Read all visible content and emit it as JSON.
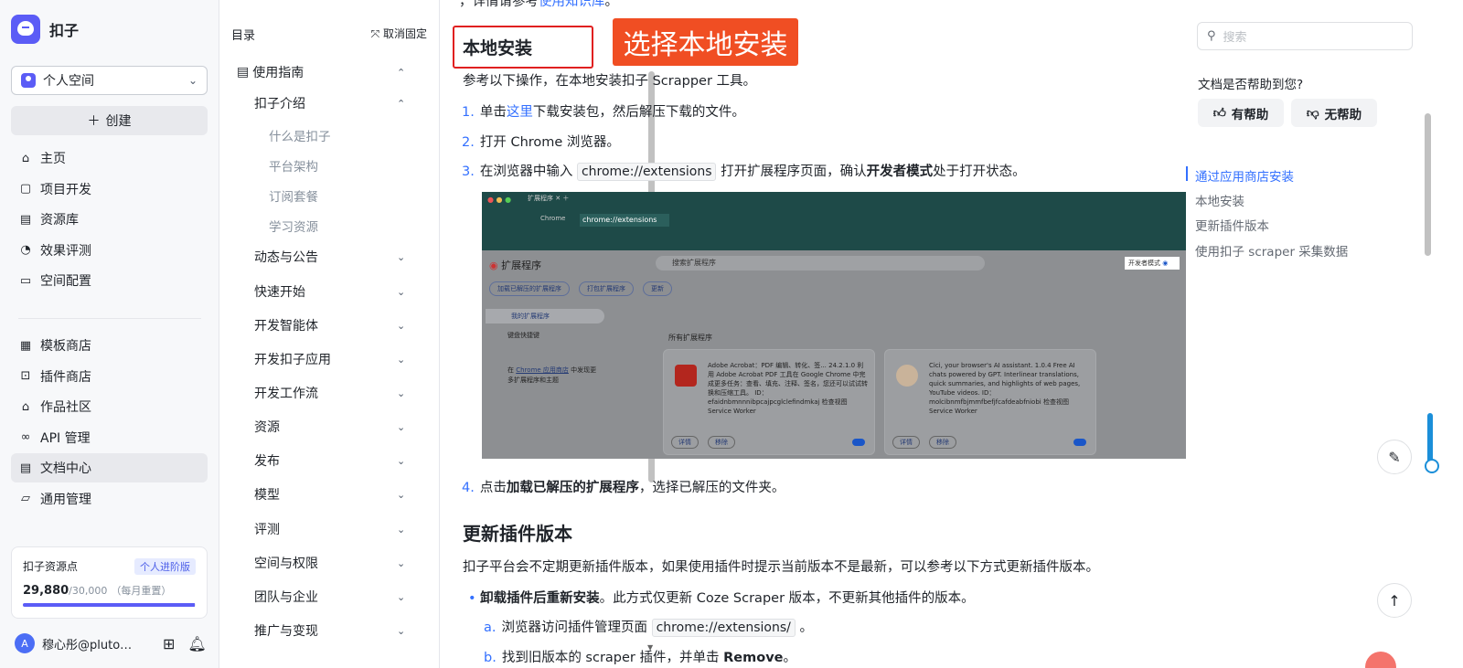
{
  "brand": {
    "name": "扣子"
  },
  "space": {
    "label": "个人空间"
  },
  "create_label": "创建",
  "nav_primary": [
    {
      "label": "主页",
      "icon": "home-icon"
    },
    {
      "label": "项目开发",
      "icon": "project-icon"
    },
    {
      "label": "资源库",
      "icon": "library-icon"
    },
    {
      "label": "效果评测",
      "icon": "evaluate-icon"
    },
    {
      "label": "空间配置",
      "icon": "space-config-icon"
    }
  ],
  "nav_secondary": [
    {
      "label": "模板商店",
      "icon": "template-icon"
    },
    {
      "label": "插件商店",
      "icon": "plugin-icon"
    },
    {
      "label": "作品社区",
      "icon": "community-icon"
    },
    {
      "label": "API 管理",
      "icon": "api-icon"
    },
    {
      "label": "文档中心",
      "icon": "doc-icon",
      "active": true
    },
    {
      "label": "通用管理",
      "icon": "manage-icon"
    }
  ],
  "points": {
    "title": "扣子资源点",
    "badge": "个人进阶版",
    "value": "29,880",
    "max": "/30,000",
    "reset": "（每月重置）",
    "fraction": 0.996
  },
  "user": {
    "name": "穆心彤@pluto…",
    "avatar_letter": "A"
  },
  "doctree": {
    "title": "目录",
    "unpin": "取消固定",
    "items": [
      {
        "label": "使用指南",
        "level": 0,
        "expanded": true
      },
      {
        "label": "扣子介绍",
        "level": 1,
        "expanded": true
      },
      {
        "label": "什么是扣子",
        "level": 2
      },
      {
        "label": "平台架构",
        "level": 2
      },
      {
        "label": "订阅套餐",
        "level": 2
      },
      {
        "label": "学习资源",
        "level": 2
      },
      {
        "label": "动态与公告",
        "level": 1
      },
      {
        "label": "快速开始",
        "level": 1
      },
      {
        "label": "开发智能体",
        "level": 1
      },
      {
        "label": "开发扣子应用",
        "level": 1
      },
      {
        "label": "开发工作流",
        "level": 1
      },
      {
        "label": "资源",
        "level": 1
      },
      {
        "label": "发布",
        "level": 1
      },
      {
        "label": "模型",
        "level": 1
      },
      {
        "label": "评测",
        "level": 1
      },
      {
        "label": "空间与权限",
        "level": 1
      },
      {
        "label": "团队与企业",
        "level": 1
      },
      {
        "label": "推广与变现",
        "level": 1
      }
    ]
  },
  "content": {
    "top_text_pre": "，详情请参考",
    "top_link": "使用知识库",
    "top_text_post": "。",
    "h_local": "本地安装",
    "annotation": "选择本地安装",
    "intro": "参考以下操作，在本地安装扣子 Scrapper 工具。",
    "step1_pre": "单击",
    "step1_link": "这里",
    "step1_post": "下载安装包，然后解压下载的文件。",
    "step2": "打开 Chrome 浏览器。",
    "step3_pre": "在浏览器中输入",
    "step3_code": "chrome://extensions",
    "step3_mid": "打开扩展程序页面，确认",
    "step3_bold": "开发者模式",
    "step3_post": "处于打开状态。",
    "step4_pre": "点击",
    "step4_bold": "加载已解压的扩展程序",
    "step4_post": "，选择已解压的文件夹。",
    "h_update": "更新插件版本",
    "update_intro": "扣子平台会不定期更新插件版本，如果使用插件时提示当前版本不是最新，可以参考以下方式更新插件版本。",
    "bullet_bold": "卸载插件后重新安装",
    "bullet_post": "。此方式仅更新 Coze Scraper 版本，不更新其他插件的版本。",
    "sub_a_pre": "浏览器访问插件管理页面",
    "sub_a_code": "chrome://extensions/",
    "sub_a_post": "。",
    "sub_b_pre": "找到旧版本的 scraper 插件，并单击",
    "sub_b_bold": "Remove",
    "sub_b_post": "。",
    "num1": "1.",
    "num2": "2.",
    "num3": "3.",
    "num4": "4.",
    "sub_a": "a.",
    "sub_b": "b."
  },
  "screenshot": {
    "url": "chrome://extensions",
    "url_host": "Chrome",
    "tab": "扩展程序",
    "title": "扩展程序",
    "search": "搜索扩展程序",
    "dev_mode": "开发者模式",
    "btn_load": "加载已解压的扩展程序",
    "btn_pack": "打包扩展程序",
    "btn_update": "更新",
    "side_mine": "我的扩展程序",
    "side_keys": "键盘快捷键",
    "side_store_pre": "在 ",
    "side_store_link": "Chrome 应用商店",
    "side_store_post": " 中发现更多扩展程序和主题",
    "all_ext": "所有扩展程序",
    "card1": "Adobe Acrobat：PDF 编辑、转化、签... 24.2.1.0 利用 Adobe Acrobat PDF 工具在 Google Chrome 中完成更多任务：查看、填充、注释、签名，您还可以试试转换和压缩工具。 ID：efaidnbmnnnibpcajpcglclefindmkaj 检查视图 Service Worker",
    "card2": "Cici, your browser's AI assistant. 1.0.4 Free AI chats powered by GPT. Interlinear translations, quick summaries, and highlights of web pages, YouTube videos. ID：molcibnmfbjmmfbefjfcafdeabfniobi 检查视图 Service Worker",
    "details": "详情",
    "remove": "移除"
  },
  "right": {
    "search_placeholder": "搜索",
    "help_question": "文档是否帮助到您?",
    "helpful": "有帮助",
    "not_helpful": "无帮助",
    "outline": [
      {
        "label": "通过应用商店安装",
        "active": true
      },
      {
        "label": "本地安装"
      },
      {
        "label": "更新插件版本"
      },
      {
        "label": "使用扣子 scraper 采集数据"
      }
    ]
  },
  "colors": {
    "accent": "#3370ff",
    "brand": "#5b5cf6",
    "annotation_red": "#e02020"
  }
}
